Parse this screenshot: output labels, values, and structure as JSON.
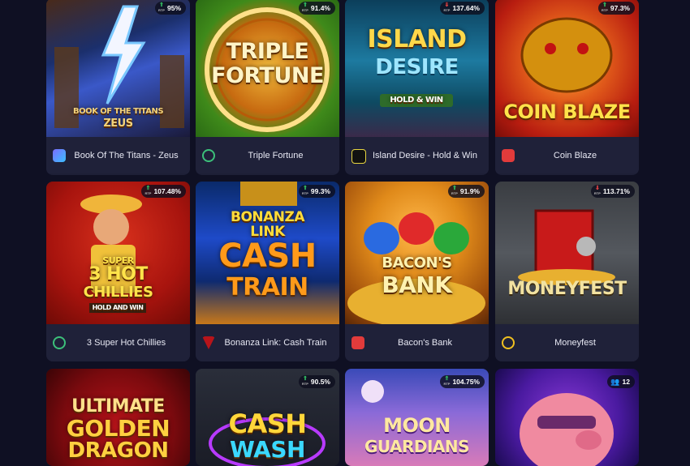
{
  "games": [
    {
      "title": "Book Of The Titans - Zeus",
      "rtp": "95%",
      "trend": "up",
      "art": [
        "BOOK OF THE TITANS",
        "ZEUS"
      ]
    },
    {
      "title": "Triple Fortune",
      "rtp": "91.4%",
      "trend": "up",
      "art": [
        "TRIPLE",
        "FORTUNE"
      ]
    },
    {
      "title": "Island Desire - Hold & Win",
      "rtp": "137.64%",
      "trend": "down",
      "art": [
        "ISLAND",
        "DESIRE",
        "HOLD & WIN"
      ]
    },
    {
      "title": "Coin Blaze",
      "rtp": "97.3%",
      "trend": "up",
      "art": [
        "COIN BLAZE"
      ]
    },
    {
      "title": "3 Super Hot Chillies",
      "rtp": "107.48%",
      "trend": "up",
      "art": [
        "SUPER",
        "3 HOT",
        "CHILLIES",
        "HOLD AND WIN"
      ]
    },
    {
      "title": "Bonanza Link: Cash Train",
      "rtp": "99.3%",
      "trend": "up",
      "art": [
        "BONANZA",
        "LINK",
        "CASH",
        "TRAIN"
      ]
    },
    {
      "title": "Bacon's Bank",
      "rtp": "91.9%",
      "trend": "up",
      "art": [
        "BACON'S",
        "BANK"
      ]
    },
    {
      "title": "Moneyfest",
      "rtp": "113.71%",
      "trend": "down",
      "art": [
        "MONEYFEST"
      ]
    },
    {
      "title": "",
      "rtp": "",
      "trend": "",
      "art": [
        "ULTIMATE",
        "GOLDEN",
        "DRAGON"
      ]
    },
    {
      "title": "",
      "rtp": "90.5%",
      "trend": "up",
      "art": [
        "CASH",
        "WASH"
      ]
    },
    {
      "title": "",
      "rtp": "104.75%",
      "trend": "up",
      "art": [
        "MOON",
        "GUARDIANS"
      ]
    },
    {
      "title": "",
      "rtp": "12",
      "trend": "players",
      "art": []
    }
  ],
  "rtp_icon_caption": "RTP"
}
